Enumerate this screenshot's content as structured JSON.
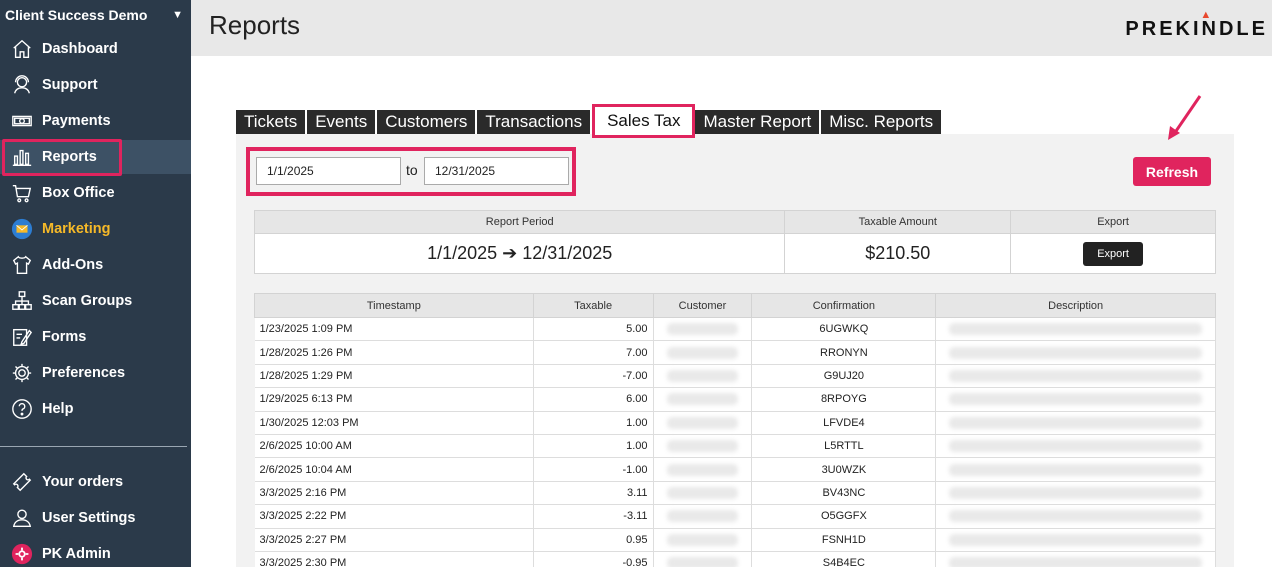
{
  "sidebar": {
    "org_name": "Client Success Demo",
    "items": [
      {
        "label": "Dashboard",
        "icon": "home-icon"
      },
      {
        "label": "Support",
        "icon": "headset-icon"
      },
      {
        "label": "Payments",
        "icon": "cash-icon"
      },
      {
        "label": "Reports",
        "icon": "bar-chart-icon"
      },
      {
        "label": "Box Office",
        "icon": "cart-icon"
      },
      {
        "label": "Marketing",
        "icon": "mail-icon"
      },
      {
        "label": "Add-Ons",
        "icon": "shirt-icon"
      },
      {
        "label": "Scan Groups",
        "icon": "sitemap-icon"
      },
      {
        "label": "Forms",
        "icon": "edit-form-icon"
      },
      {
        "label": "Preferences",
        "icon": "gear-icon"
      },
      {
        "label": "Help",
        "icon": "help-icon"
      }
    ],
    "bottom_items": [
      {
        "label": "Your orders",
        "icon": "ticket-icon"
      },
      {
        "label": "User Settings",
        "icon": "user-icon"
      },
      {
        "label": "PK Admin",
        "icon": "admin-gear-icon"
      }
    ]
  },
  "header": {
    "title": "Reports",
    "logo": "PREKINDLE"
  },
  "tabs": [
    "Tickets",
    "Events",
    "Customers",
    "Transactions",
    "Sales Tax",
    "Master Report",
    "Misc. Reports"
  ],
  "active_tab": "Sales Tax",
  "filters": {
    "start_date": "1/1/2025",
    "to_label": "to",
    "end_date": "12/31/2025"
  },
  "refresh_label": "Refresh",
  "summary": {
    "headers": [
      "Report Period",
      "Taxable Amount",
      "Export"
    ],
    "period": "1/1/2025 ➔ 12/31/2025",
    "amount": "$210.50",
    "export_label": "Export"
  },
  "detail": {
    "headers": [
      "Timestamp",
      "Taxable",
      "Customer",
      "Confirmation",
      "Description"
    ],
    "rows": [
      {
        "timestamp": "1/23/2025 1:09 PM",
        "taxable": "5.00",
        "confirmation": "6UGWKQ"
      },
      {
        "timestamp": "1/28/2025 1:26 PM",
        "taxable": "7.00",
        "confirmation": "RRONYN"
      },
      {
        "timestamp": "1/28/2025 1:29 PM",
        "taxable": "-7.00",
        "confirmation": "G9UJ20"
      },
      {
        "timestamp": "1/29/2025 6:13 PM",
        "taxable": "6.00",
        "confirmation": "8RPOYG"
      },
      {
        "timestamp": "1/30/2025 12:03 PM",
        "taxable": "1.00",
        "confirmation": "LFVDE4"
      },
      {
        "timestamp": "2/6/2025 10:00 AM",
        "taxable": "1.00",
        "confirmation": "L5RTTL"
      },
      {
        "timestamp": "2/6/2025 10:04 AM",
        "taxable": "-1.00",
        "confirmation": "3U0WZK"
      },
      {
        "timestamp": "3/3/2025 2:16 PM",
        "taxable": "3.11",
        "confirmation": "BV43NC"
      },
      {
        "timestamp": "3/3/2025 2:22 PM",
        "taxable": "-3.11",
        "confirmation": "O5GGFX"
      },
      {
        "timestamp": "3/3/2025 2:27 PM",
        "taxable": "0.95",
        "confirmation": "FSNH1D"
      },
      {
        "timestamp": "3/3/2025 2:30 PM",
        "taxable": "-0.95",
        "confirmation": "S4B4EC"
      }
    ]
  },
  "colors": {
    "accent": "#e0245e",
    "sidebar": "#2b3a4a",
    "marketing": "#f6b928",
    "positive": "#2c9a2c",
    "negative": "#d93030"
  }
}
